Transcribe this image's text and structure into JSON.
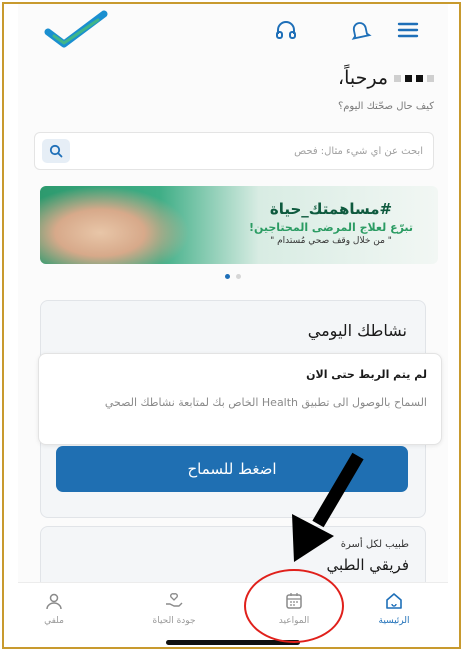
{
  "header": {
    "logo": "check-logo-icon",
    "icons": [
      "headset-icon",
      "bell-icon",
      "menu-icon"
    ],
    "accent": "#1e6fb8"
  },
  "greeting": {
    "title": "مرحباً،",
    "subtitle": "كيف حال صحّتك اليوم؟"
  },
  "search": {
    "placeholder": "ابحث عن أي شيء مثال: فحص",
    "icon": "search-icon"
  },
  "banner": {
    "title": "#مساهمتك_حياة",
    "line1": "تبرّع لعلاج المرضى المحتاجين!",
    "line2": "\" من خلال وقف صحي مُستدام \""
  },
  "carousel": {
    "pages": 2,
    "active": 0
  },
  "activity": {
    "title": "نشاطك اليومي",
    "notice_title": "لم يتم الربط حتى الان",
    "notice_body": "السماح بالوصول الى تطبيق Health الخاص بك لمتابعة نشاطك الصحي",
    "button_label": "اضغط للسماح"
  },
  "team": {
    "subtitle": "طبيب لكل أسرة",
    "title": "فريقي الطبي"
  },
  "tabbar": {
    "items": [
      {
        "label": "الرئيسية",
        "icon": "home-icon",
        "active": true
      },
      {
        "label": "المواعيد",
        "icon": "calendar-icon",
        "active": false
      },
      {
        "label": "جودة الحياة",
        "icon": "wellness-hand-icon",
        "active": false
      },
      {
        "label": "ملفي",
        "icon": "profile-icon",
        "active": false
      }
    ]
  },
  "annotation": {
    "color": "#e0201b",
    "target": "المواعيد"
  }
}
